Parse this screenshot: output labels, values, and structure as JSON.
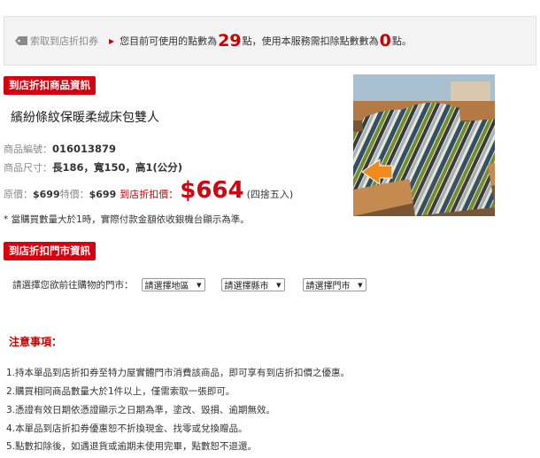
{
  "topbar": {
    "coupon_link": "索取到店折扣券",
    "points_prefix": "您目前可使用的點數為",
    "points_available": "29",
    "points_middle": "點，使用本服務需扣除點數數為",
    "points_required": "0",
    "points_suffix": "點。"
  },
  "section_product": {
    "label": "到店折扣商品資訊"
  },
  "product": {
    "name": "繽紛條紋保暖柔絨床包雙人",
    "code_label": "商品編號：",
    "code": "016013879",
    "size_label": "商品尺寸：",
    "size": "長186，寬150，高1(公分)",
    "orig_label": "原價：",
    "orig_price": "$699",
    "special_label": "特價：",
    "special_price": "$699",
    "discount_label": "到店折扣價：",
    "discount_price": "$664",
    "rounding_note": "(四捨五入)",
    "qty_note": "* 當購買數量大於1時，實際付款金額依收銀機台顯示為準。"
  },
  "section_store": {
    "label": "到店折扣門市資訊"
  },
  "store_select": {
    "prompt": "請選擇您欲前往購物的門市：",
    "region": "請選擇地區",
    "county": "請選擇縣市",
    "store": "請選擇門市"
  },
  "notes": {
    "title": "注意事項：",
    "items": [
      "1.持本單品到店折扣券至特力屋實體門市消費該商品，即可享有到店折扣價之優惠。",
      "2.購買相同商品數量大於1件以上，僅需索取一張即可。",
      "3.憑證有效日期依憑證顯示之日期為準，塗改、毀損、逾期無效。",
      "4.本單品到店折扣券優惠恕不折換現金、找零或兌換贈品。",
      "5.點數扣除後，如遇退貨或逾期未使用完畢，點數恕不退還。"
    ]
  },
  "colors": {
    "accent_red": "#d7000f",
    "price_red": "#cc0000",
    "bar_bg": "#f3f3f3"
  },
  "icons": {
    "coupon": "tag-icon",
    "pointer": "triangle-right-icon",
    "select": "chevron-down-icon"
  }
}
